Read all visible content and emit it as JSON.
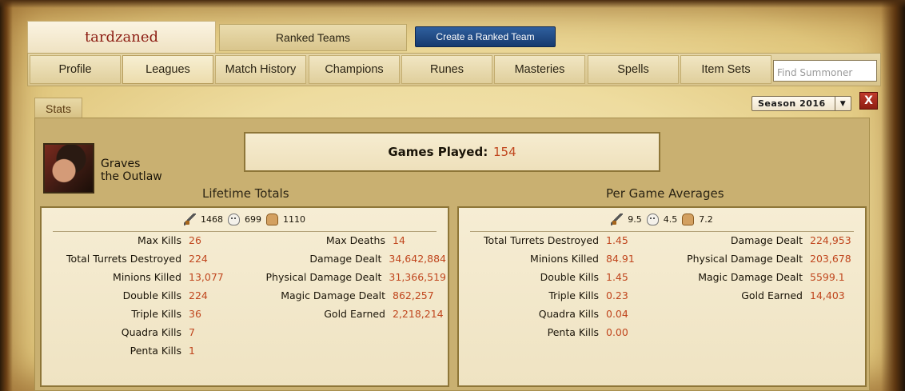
{
  "header": {
    "summoner_name": "tardzaned",
    "ranked_teams_tab": "Ranked Teams",
    "create_team_button": "Create a Ranked Team"
  },
  "nav": {
    "items": [
      {
        "label": "Profile"
      },
      {
        "label": "Leagues",
        "active": true
      },
      {
        "label": "Match History"
      },
      {
        "label": "Champions"
      },
      {
        "label": "Runes"
      },
      {
        "label": "Masteries"
      },
      {
        "label": "Spells"
      },
      {
        "label": "Item Sets"
      }
    ],
    "search_placeholder": "Find Summoner"
  },
  "stats_tab": "Stats",
  "season_select": "Season 2016",
  "close_label": "X",
  "champion": {
    "name_line1": "Graves",
    "name_line2": "the Outlaw"
  },
  "games_played": {
    "label": "Games Played",
    "value": "154"
  },
  "lifetime": {
    "title": "Lifetime Totals",
    "kills": "1468",
    "deaths": "699",
    "assists": "1110",
    "left": [
      {
        "label": "Max Kills",
        "value": "26"
      },
      {
        "label": "Total Turrets Destroyed",
        "value": "224"
      },
      {
        "label": "Minions Killed",
        "value": "13,077"
      },
      {
        "label": "Double Kills",
        "value": "224"
      },
      {
        "label": "Triple Kills",
        "value": "36"
      },
      {
        "label": "Quadra Kills",
        "value": "7"
      },
      {
        "label": "Penta Kills",
        "value": "1"
      }
    ],
    "right": [
      {
        "label": "Max Deaths",
        "value": "14"
      },
      {
        "label": "Damage Dealt",
        "value": "34,642,884"
      },
      {
        "label": "Physical Damage Dealt",
        "value": "31,366,519"
      },
      {
        "label": "Magic Damage Dealt",
        "value": "862,257"
      },
      {
        "label": "Gold Earned",
        "value": "2,218,214"
      }
    ]
  },
  "averages": {
    "title": "Per Game Averages",
    "kills": "9.5",
    "deaths": "4.5",
    "assists": "7.2",
    "left": [
      {
        "label": "Total Turrets Destroyed",
        "value": "1.45"
      },
      {
        "label": "Minions Killed",
        "value": "84.91"
      },
      {
        "label": "Double Kills",
        "value": "1.45"
      },
      {
        "label": "Triple Kills",
        "value": "0.23"
      },
      {
        "label": "Quadra Kills",
        "value": "0.04"
      },
      {
        "label": "Penta Kills",
        "value": "0.00"
      }
    ],
    "right": [
      {
        "label": "Damage Dealt",
        "value": "224,953"
      },
      {
        "label": "Physical Damage Dealt",
        "value": "203,678"
      },
      {
        "label": "Magic Damage Dealt",
        "value": "5599.1"
      },
      {
        "label": "Gold Earned",
        "value": "14,403"
      }
    ]
  },
  "colors": {
    "value_orange": "#c0461e",
    "summoner_red": "#8c1c12",
    "button_blue": "#163a6e"
  }
}
